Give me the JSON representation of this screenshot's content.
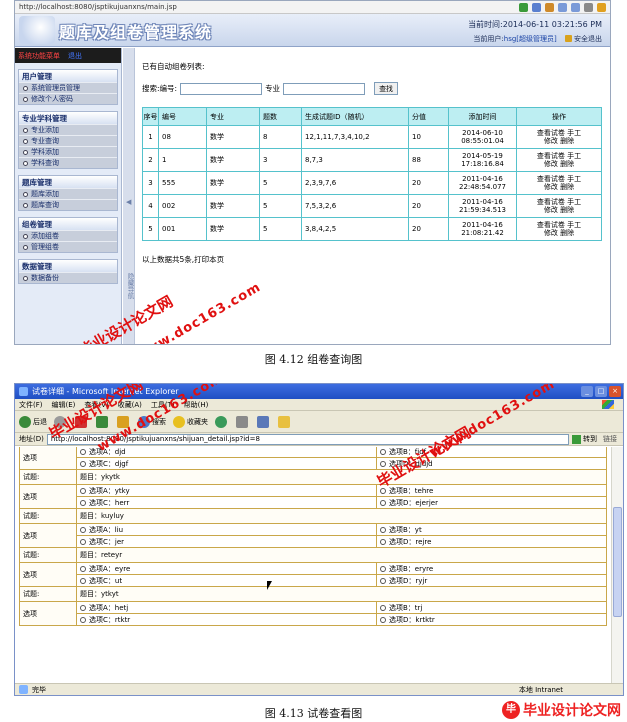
{
  "shot1": {
    "url": "http://localhost:8080/jsptikujuanxns/main.jsp",
    "system_title": "题库及组卷管理系统",
    "time_label": "当前时间:2014-06-11 03:21:56 PM",
    "user_prefix": "当前用户:",
    "user_name": "hsg[超级管理员]",
    "logout": "安全退出",
    "sidebar": {
      "menu_label": "系统功能菜单",
      "exit_label": "退出",
      "groups": [
        {
          "title": "用户管理",
          "items": [
            "系统管理员管理",
            "修改个人密码"
          ]
        },
        {
          "title": "专业学科管理",
          "items": [
            "专业添加",
            "专业查询",
            "学科添加",
            "学科查询"
          ]
        },
        {
          "title": "题库管理",
          "items": [
            "题库添加",
            "题库查询"
          ]
        },
        {
          "title": "组卷管理",
          "items": [
            "添加组卷",
            "管理组卷"
          ]
        },
        {
          "title": "数据管理",
          "items": [
            "数据备份"
          ]
        }
      ],
      "collapse_text": "隐藏导航"
    },
    "list_caption": "已有自动组卷列表:",
    "search": {
      "code_label": "搜索:编号:",
      "major_label": "专业",
      "button": "查找"
    },
    "table": {
      "headers": [
        "序号",
        "编号",
        "专业",
        "题数",
        "生成试题ID（随机）",
        "分值",
        "添加时间",
        "操作"
      ],
      "rows": [
        {
          "no": "1",
          "code": "08",
          "major": "数学",
          "count": "8",
          "ids": "12,1,11,7,3,4,10,2",
          "score": "10",
          "date": "2014-06-10",
          "time": "08:55:01.04"
        },
        {
          "no": "2",
          "code": "1",
          "major": "数学",
          "count": "3",
          "ids": "8,7,3",
          "score": "88",
          "date": "2014-05-19",
          "time": "17:18:16.84"
        },
        {
          "no": "3",
          "code": "555",
          "major": "数学",
          "count": "5",
          "ids": "2,3,9,7,6",
          "score": "20",
          "date": "2011-04-16",
          "time": "22:48:54.077"
        },
        {
          "no": "4",
          "code": "002",
          "major": "数学",
          "count": "5",
          "ids": "7,5,3,2,6",
          "score": "20",
          "date": "2011-04-16",
          "time": "21:59:34.513"
        },
        {
          "no": "5",
          "code": "001",
          "major": "数学",
          "count": "5",
          "ids": "3,8,4,2,5",
          "score": "20",
          "date": "2011-04-16",
          "time": "21:08:21.42"
        }
      ],
      "op_line1": "查看试卷 手工",
      "op_line2": "修改 删除"
    },
    "total": "以上数据共5条,打印本页"
  },
  "caption1": "图 4.12 组卷查询图",
  "shot2": {
    "window_title": "试卷详细 - Microsoft Internet Explorer",
    "menu": [
      "文件(F)",
      "编辑(E)",
      "查看(V)",
      "收藏(A)",
      "工具(T)",
      "帮助(H)"
    ],
    "toolbar": {
      "back": "后退",
      "search": "搜索",
      "favorites": "收藏夹"
    },
    "address_label": "地址(D)",
    "url": "http://localhost:8080/jsptikujuanxns/shijuan_detail.jsp?id=8",
    "go": "转到",
    "links": "链接",
    "option_label": "选项",
    "question_label": "试题:",
    "first_options": {
      "a": "选项A：djd",
      "b": "选项B：fjdf",
      "c": "选项C：djgf",
      "d": "选项D：djdjd"
    },
    "questions": [
      {
        "title": "题目：ykytk",
        "a": "选项A：ytky",
        "b": "选项B：tehre",
        "c": "选项C：herr",
        "d": "选项D：ejerjer"
      },
      {
        "title": "题目：kuyluy",
        "a": "选项A：liu",
        "b": "选项B：yt",
        "c": "选项C：jer",
        "d": "选项D：rejre"
      },
      {
        "title": "题目：reteyr",
        "a": "选项A：eyre",
        "b": "选项B：eryre",
        "c": "选项C：ut",
        "d": "选项D：ryjr"
      },
      {
        "title": "题目：ytkyt",
        "a": "选项A：hetj",
        "b": "选项B：trj",
        "c": "选项C：rtktr",
        "d": "选项D：krtktr"
      }
    ],
    "status": "完毕",
    "zone": "本地 Intranet"
  },
  "caption2": "图 4.13 试卷查看图",
  "watermark_cn": "毕业设计论文网",
  "watermark_url": "www.doc163.com",
  "logo_text": "毕业设计论文网",
  "logo_sub": "www.56doc.com",
  "accent_color": "#e01010"
}
